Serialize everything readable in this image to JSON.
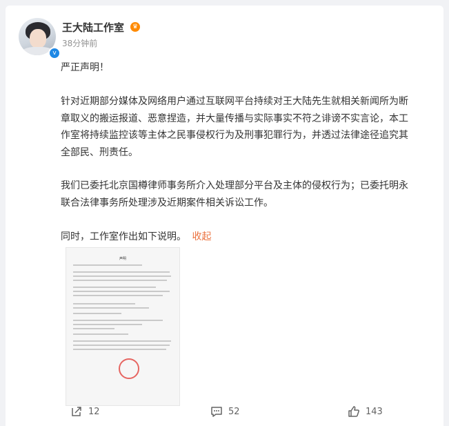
{
  "post": {
    "author": "王大陆工作室",
    "time": "38分钟前",
    "paragraphs": [
      [
        "严正声明！"
      ],
      [
        "针对近期部分媒体及网络用户通过互联网平台持续对王大陆先生就相关新闻所为断",
        "章取义的搬运报道、恶意捏造，并大量传播与实际事实不符之诽谤不实言论，本工",
        "作室将持续监控该等主体之民事侵权行为及刑事犯罪行为，并透过法律途径追究其",
        "全部民、刑责任。"
      ],
      [
        "我们已委托北京国樽律师事务所介入处理部分平台及主体的侵权行为；已委托明永",
        "联合法律事务所处理涉及近期案件相关诉讼工作。"
      ],
      [
        "同时，工作室作出如下说明。"
      ]
    ],
    "collapse_label": "收起",
    "image": {
      "doc_title": "声明"
    }
  },
  "actions": {
    "repost_count": "12",
    "comment_count": "52",
    "like_count": "143"
  },
  "colors": {
    "link": "#eb7340",
    "verified": "#1e88e5",
    "background": "#f1f2f5"
  },
  "icons": [
    "verified-badge-icon",
    "crown-icon",
    "repost-icon",
    "comment-icon",
    "like-icon"
  ]
}
